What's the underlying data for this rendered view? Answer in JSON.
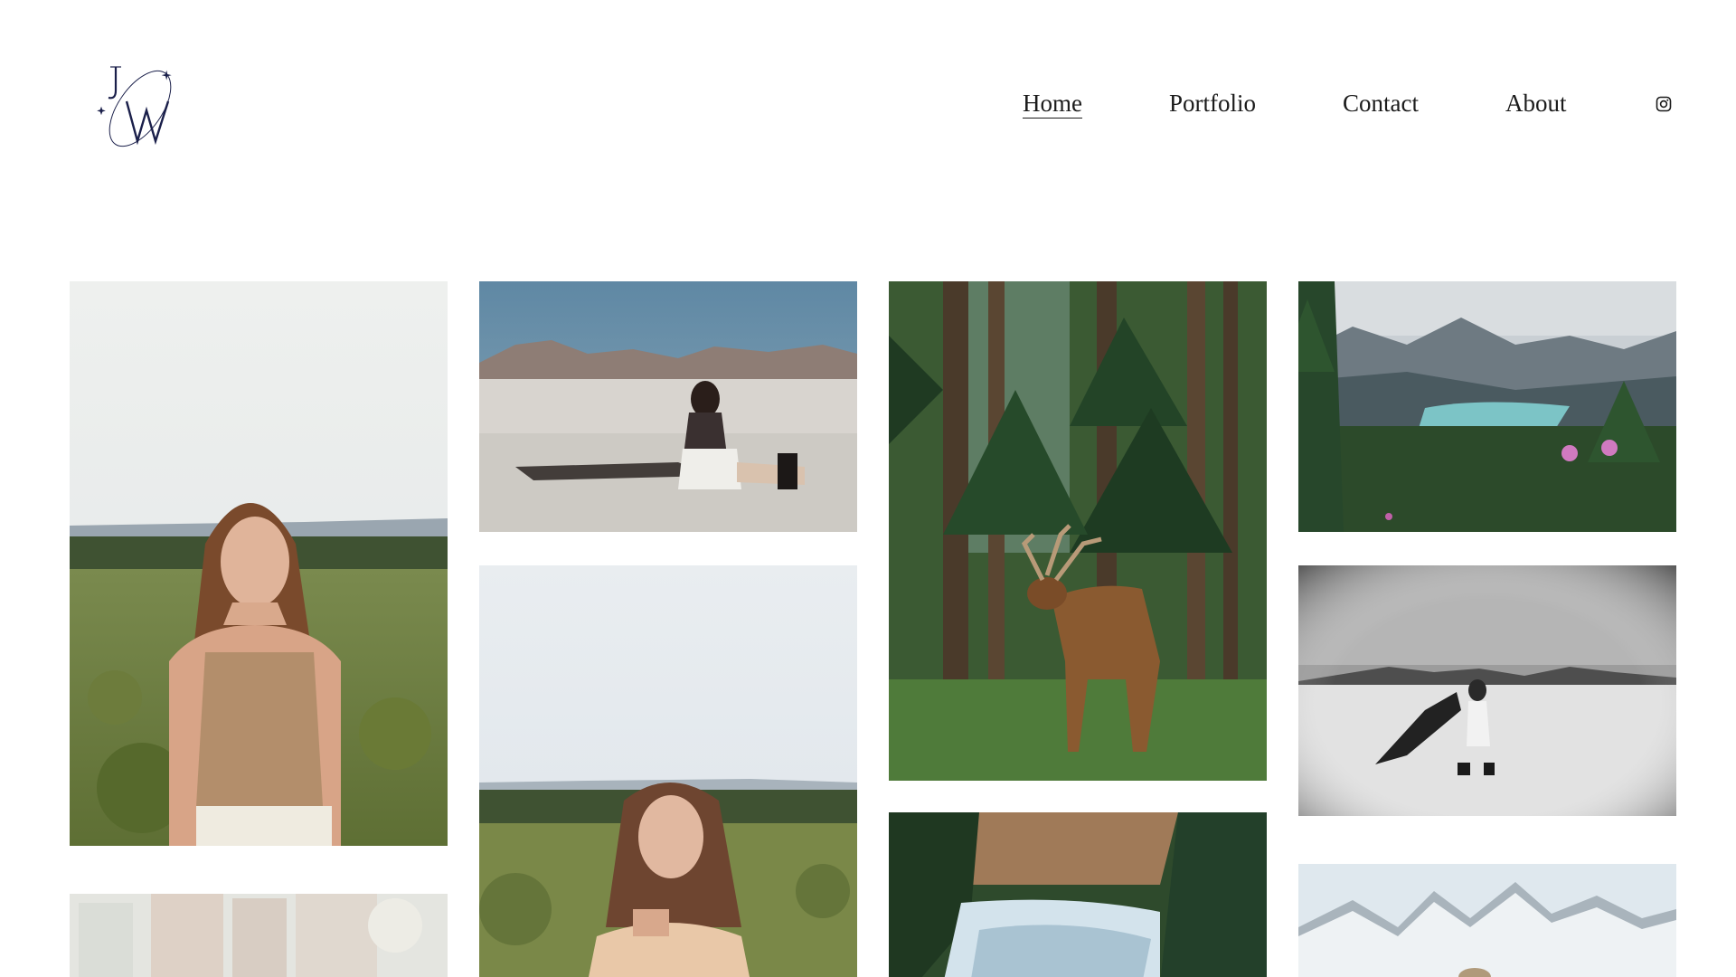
{
  "site": {
    "logo_letters": "JW"
  },
  "nav": {
    "items": [
      {
        "label": "Home",
        "active": true
      },
      {
        "label": "Portfolio",
        "active": false
      },
      {
        "label": "Contact",
        "active": false
      },
      {
        "label": "About",
        "active": false
      }
    ],
    "social_icon": "instagram-icon"
  },
  "gallery": {
    "images": [
      {
        "id": "woman-sagebrush-portrait",
        "icon": "photo-portrait"
      },
      {
        "id": "woman-salt-flat-seated",
        "icon": "photo-salt-flat"
      },
      {
        "id": "woman-sagebrush-chin-rest",
        "icon": "photo-portrait"
      },
      {
        "id": "elk-in-forest",
        "icon": "photo-elk"
      },
      {
        "id": "river-canyon",
        "icon": "photo-river"
      },
      {
        "id": "mountain-lake-flowers",
        "icon": "photo-lake"
      },
      {
        "id": "bw-salt-flat-veil",
        "icon": "photo-bw"
      },
      {
        "id": "snowy-peaks",
        "icon": "photo-peaks"
      },
      {
        "id": "city-street",
        "icon": "photo-street"
      }
    ]
  },
  "colors": {
    "logo": "#1a1f4a",
    "nav_text": "#1b1b1b",
    "background": "#ffffff"
  }
}
